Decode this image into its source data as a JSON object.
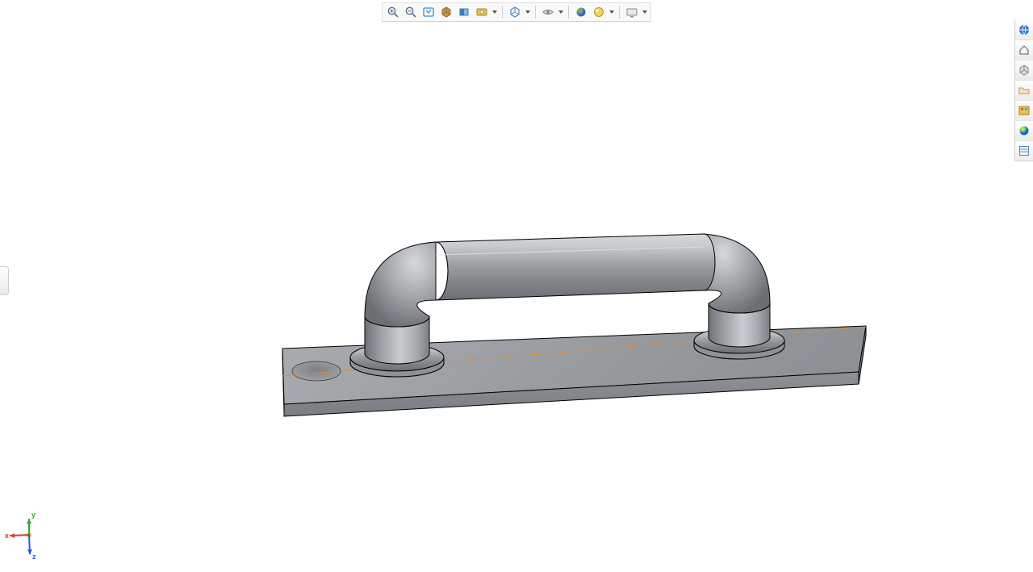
{
  "triad": {
    "x_label": "x",
    "y_label": "y",
    "z_label": "z",
    "x_color": "#e23b2a",
    "y_color": "#2fa82f",
    "z_color": "#2a55e2"
  },
  "top_toolbar": {
    "items": [
      {
        "name": "zoom-in-icon",
        "dropdown": false
      },
      {
        "name": "zoom-out-icon",
        "dropdown": false
      },
      {
        "name": "zoom-fit-icon",
        "dropdown": false
      },
      {
        "name": "view-orientation-icon",
        "dropdown": false
      },
      {
        "name": "section-view-icon",
        "dropdown": false
      },
      {
        "name": "screen-capture-icon",
        "dropdown": true
      },
      {
        "separator": true
      },
      {
        "name": "display-style-icon",
        "dropdown": true
      },
      {
        "separator": true
      },
      {
        "name": "hide-show-icon",
        "dropdown": true
      },
      {
        "separator": true
      },
      {
        "name": "scene-icon",
        "dropdown": false
      },
      {
        "name": "appearance-icon",
        "dropdown": true
      },
      {
        "separator": true
      },
      {
        "name": "viewport-icon",
        "dropdown": true
      }
    ]
  },
  "right_toolbar": {
    "items": [
      {
        "name": "web-icon"
      },
      {
        "name": "home-icon"
      },
      {
        "name": "resource-box-icon"
      },
      {
        "name": "folder-icon"
      },
      {
        "name": "appearances-panel-icon"
      },
      {
        "name": "render-tools-icon"
      },
      {
        "name": "properties-panel-icon"
      }
    ]
  },
  "model": {
    "material_base": "#9a9da1",
    "material_light": "#c7cace",
    "material_dark": "#6b6e72",
    "edge_color": "#000000",
    "sketch_line_color": "#e68a2e"
  }
}
